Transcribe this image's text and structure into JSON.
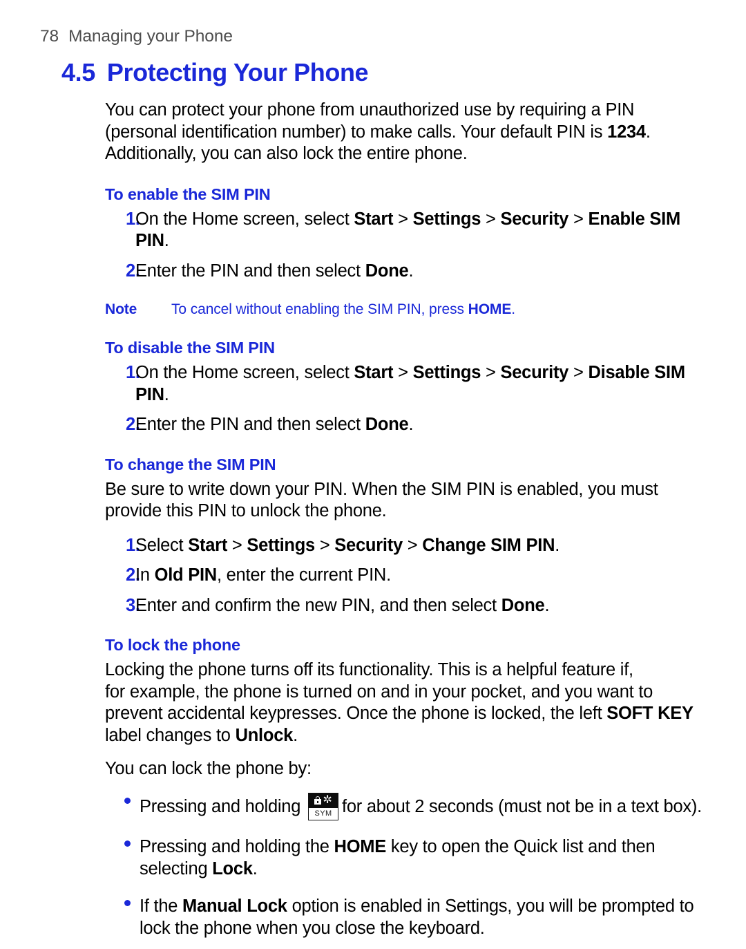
{
  "header": {
    "page_number": "78",
    "section_title": "Managing your Phone"
  },
  "title": {
    "number": "4.5",
    "text": "Protecting Your Phone"
  },
  "colors": {
    "heading_blue": "#1a28d8",
    "header_gray": "#4d4d4d",
    "body_black": "#000000"
  },
  "intro": {
    "line1": "You can protect your phone from unauthorized use by requiring a PIN",
    "line2_a": "(personal identification number) to make calls. Your default PIN is ",
    "line2_bold": "1234",
    "line2_b": ".",
    "line3": "Additionally, you can also lock the entire phone."
  },
  "sections": {
    "enable": {
      "heading": "To enable the SIM PIN",
      "step1": {
        "marker": "1.",
        "pre": "On the Home screen, select ",
        "b1": "Start",
        "sep1": " > ",
        "b2": "Settings",
        "sep2": " > ",
        "b3": "Security",
        "sep3": " > ",
        "b4": "Enable SIM PIN",
        "post": "."
      },
      "step2": {
        "marker": "2.",
        "pre": "Enter the PIN and then select ",
        "b1": "Done",
        "post": "."
      },
      "note": {
        "label": "Note",
        "pre": "To cancel without enabling the SIM PIN, press ",
        "bold": "HOME",
        "post": "."
      }
    },
    "disable": {
      "heading": "To disable the SIM PIN",
      "step1": {
        "marker": "1.",
        "pre": "On the Home screen, select ",
        "b1": "Start",
        "sep1": " > ",
        "b2": "Settings",
        "sep2": " > ",
        "b3": "Security",
        "sep3": " > ",
        "b4": "Disable SIM PIN",
        "post": "."
      },
      "step2": {
        "marker": "2.",
        "pre": "Enter the PIN and then select ",
        "b1": "Done",
        "post": "."
      }
    },
    "change": {
      "heading": "To change the SIM PIN",
      "para_line1": "Be sure to write down your PIN. When the SIM PIN is enabled, you must",
      "para_line2": "provide this PIN to unlock the phone.",
      "step1": {
        "marker": "1.",
        "pre": "Select ",
        "b1": "Start",
        "sep1": " > ",
        "b2": "Settings",
        "sep2": " > ",
        "b3": "Security",
        "sep3": " > ",
        "b4": "Change SIM PIN",
        "post": "."
      },
      "step2": {
        "marker": "2.",
        "pre": "In ",
        "b1": "Old PIN",
        "post": ", enter the current PIN."
      },
      "step3": {
        "marker": "3.",
        "pre": "Enter and confirm the new PIN, and then select ",
        "b1": "Done",
        "post": "."
      }
    },
    "lock": {
      "heading": "To lock the phone",
      "para_line1": "Locking the phone turns off its functionality. This is a helpful feature if,",
      "para_line2": "for example, the phone is turned on and in your pocket, and you want to",
      "para_line3_pre": "prevent accidental keypresses. Once the phone is locked, the left ",
      "para_line3_bold": "SOFT KEY",
      "para_line4_pre": "label changes to ",
      "para_line4_bold": "Unlock",
      "para_line4_post": ".",
      "lead_in": "You can lock the phone by:",
      "bullets": [
        {
          "pre": "Pressing and holding ",
          "icon": "sym-key-icon",
          "icon_label": "SYM",
          "post": "for about 2 seconds (must not be in a text box)."
        },
        {
          "pre": "Pressing and holding the ",
          "b1": "HOME",
          "mid": " key to open the Quick list and then selecting ",
          "b2": "Lock",
          "post": "."
        },
        {
          "pre": "If the ",
          "b1": "Manual Lock",
          "mid": " option is enabled in Settings, you will be prompted to lock the phone when you close the keyboard.",
          "post": ""
        }
      ]
    }
  }
}
